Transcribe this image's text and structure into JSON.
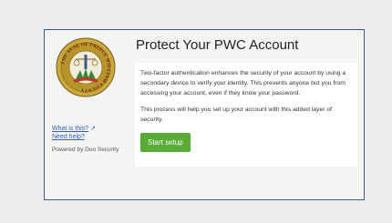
{
  "frame": {
    "title": "Protect Your PWC Account",
    "border_color": "#3b5a8c"
  },
  "sidebar": {
    "seal_alt": "Seal of Prince William County",
    "seal_lettering": "THE SEAL OF PRINCE WILLIAM COUNTY",
    "what_is_this_label": "What is this?",
    "need_help_label": "Need help?",
    "powered_by_label": "Powered by Duo Security",
    "link_color": "#2f5eb0"
  },
  "content": {
    "paragraph_1": "Two-factor authentication enhances the security of your account by using a secondary device to verify your identity. This prevents anyone but you from accessing your account, even if they know your password.",
    "paragraph_2": "This process will help you set up your account with this added layer of security.",
    "start_button_label": "Start setup",
    "button_color": "#59ab38"
  },
  "icons": {
    "external_link": "external-link-icon"
  }
}
